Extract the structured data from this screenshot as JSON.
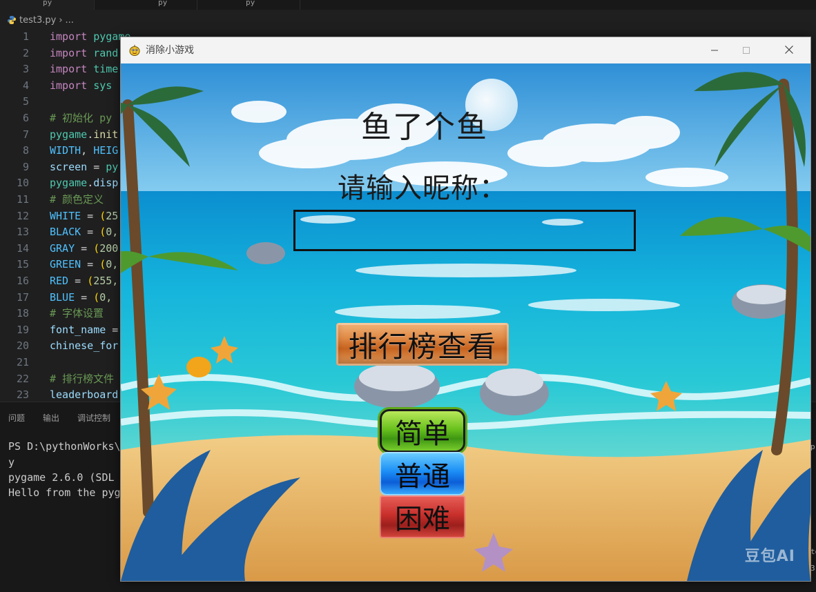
{
  "editor": {
    "tabs": [
      {
        "label": "py"
      },
      {
        "label": "py"
      },
      {
        "label": "py"
      }
    ],
    "breadcrumb": {
      "file": "test3.py",
      "separator": "›",
      "rest": "..."
    },
    "lines": [
      {
        "num": "1"
      },
      {
        "num": "2"
      },
      {
        "num": "3"
      },
      {
        "num": "4"
      },
      {
        "num": "5"
      },
      {
        "num": "6"
      },
      {
        "num": "7"
      },
      {
        "num": "8"
      },
      {
        "num": "9"
      },
      {
        "num": "10"
      },
      {
        "num": "11"
      },
      {
        "num": "12"
      },
      {
        "num": "13"
      },
      {
        "num": "14"
      },
      {
        "num": "15"
      },
      {
        "num": "16"
      },
      {
        "num": "17"
      },
      {
        "num": "18"
      },
      {
        "num": "19"
      },
      {
        "num": "20"
      },
      {
        "num": "21"
      },
      {
        "num": "22"
      },
      {
        "num": "23"
      }
    ],
    "code": {
      "l1": {
        "kw": "import",
        "mod": "pygame"
      },
      "l2": {
        "kw": "import",
        "mod": "rand"
      },
      "l3": {
        "kw": "import",
        "mod": "time"
      },
      "l4": {
        "kw": "import",
        "mod": "sys"
      },
      "l6": "# 初始化 py",
      "l7": {
        "a": "pygame",
        "b": ".",
        "c": "init"
      },
      "l8": {
        "a": "WIDTH",
        "b": ", ",
        "c": "HEIG"
      },
      "l9": {
        "a": "screen",
        "b": " = ",
        "c": "py"
      },
      "l10": {
        "a": "pygame",
        "b": ".",
        "c": "disp"
      },
      "l11": "# 颜色定义",
      "l12": {
        "a": "WHITE",
        "b": " = ",
        "c": "(",
        "d": "25"
      },
      "l13": {
        "a": "BLACK",
        "b": " = ",
        "c": "(",
        "d": "0,"
      },
      "l14": {
        "a": "GRAY",
        "b": " = ",
        "c": "(",
        "d": "200"
      },
      "l15": {
        "a": "GREEN",
        "b": " = ",
        "c": "(",
        "d": "0,"
      },
      "l16": {
        "a": "RED",
        "b": " = ",
        "c": "(",
        "d": "255,"
      },
      "l17": {
        "a": "BLUE",
        "b": " = ",
        "c": "(",
        "d": "0,"
      },
      "l18": "# 字体设置",
      "l19": {
        "a": "font_name",
        "b": " ="
      },
      "l20": {
        "a": "chinese_for"
      },
      "l22": "# 排行榜文件",
      "l23": {
        "a": "leaderboard"
      }
    }
  },
  "panel": {
    "tabs": [
      "问题",
      "输出",
      "调试控制"
    ],
    "terminal": [
      "PS D:\\pythonWorks\\",
      "y",
      "pygame 2.6.0 (SDL",
      "Hello from the pyg"
    ],
    "right_fragments": [
      "p",
      "to",
      "3"
    ]
  },
  "game": {
    "window_title": "消除小游戏",
    "title": "鱼了个鱼",
    "nickname_label": "请输入昵称：",
    "nickname_value": "",
    "buttons": {
      "leaderboard": "排行榜查看",
      "easy": "简单",
      "normal": "普通",
      "hard": "困难"
    },
    "watermark": "豆包AI",
    "colors": {
      "sky": "#4fb0e6",
      "sea": "#12a7cc",
      "sand": "#e9b767",
      "leaderboard_button": "#d9803d",
      "easy_button": "#5bb61f",
      "normal_button": "#1b8ef5",
      "hard_button": "#c9302c"
    }
  }
}
